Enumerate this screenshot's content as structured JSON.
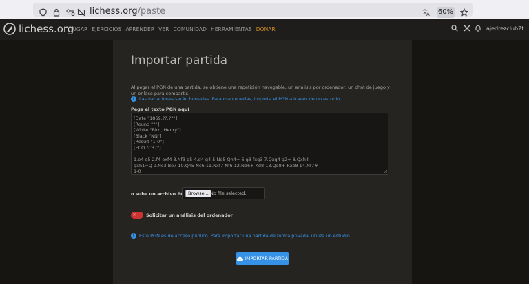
{
  "browser": {
    "url_host": "lichess.org",
    "url_path": "/paste",
    "zoom": "60%"
  },
  "header": {
    "brand": "lichess.org",
    "nav": [
      "JUGAR",
      "EJERCICIOS",
      "APRENDER",
      "VER",
      "COMUNIDAD",
      "HERRAMIENTAS",
      "DONAR"
    ],
    "username": "ajedrezclub2t"
  },
  "page": {
    "title": "Importar partida",
    "description": "Al pegar el PGN de una partida, se obtiene una repetición navegable, un análisis por ordenador, un chat de juego y un enlace para compartir.",
    "variations_note": "Las variaciones serán borradas. Para mantenerlas, importa el PGN a través de un estudio.",
    "pgn_label": "Pega el texto PGN aquí",
    "pgn_text": "[Date \"1869.??.??\"]\n[Round \"?\"]\n[White \"Bird, Henry\"]\n[Black \"NN\"]\n[Result \"1-0\"]\n[ECO \"C37\"]\n\n1.e4 e5 2.f4 exf4 3.Nf3 g5 4.d4 g4 5.Ne5 Qh4+ 6.g3 fxg3 7.Qxg4 g2+ 8.Qxh4\ngxh1=Q 9.Nc3 Be7 10.Qh5 Nc6 11.Nxf7 Nf6 12.Nd6+ Kd8 13.Qe8+ Rxe8 14.Nf7#\n1-0",
    "file_label": "o sube un archivo PGN",
    "browse_label": "Browse...",
    "no_file": "No file selected.",
    "analysis_label": "Solicitar un análisis del ordenador",
    "public_note": "Este PGN es de acceso público. Para importar una partida de forma privada, utiliza un estudio.",
    "import_button": "IMPORTAR PARTIDA"
  },
  "colors": {
    "accent": "#3692e7",
    "donate": "#d59020",
    "toggle_off": "#cc3333"
  }
}
